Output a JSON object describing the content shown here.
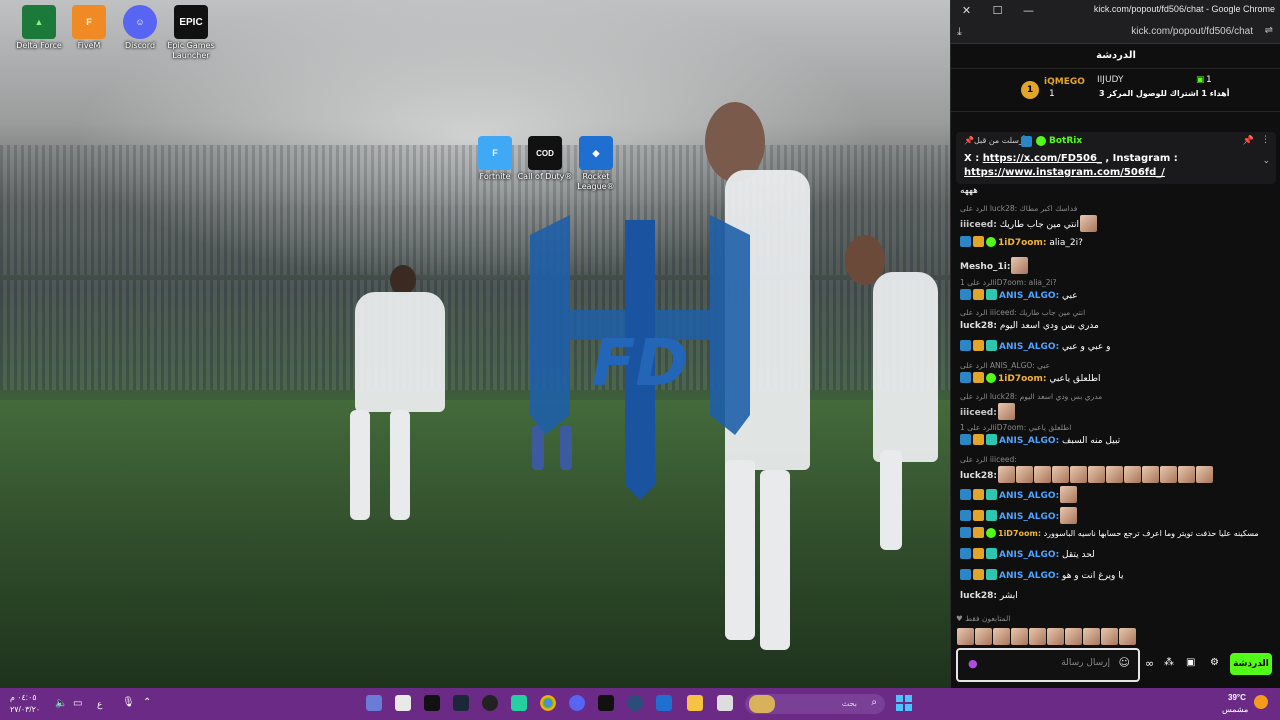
{
  "desktop_icons": [
    {
      "name": "delta-force-icon",
      "label": "Delta Force",
      "color": "#1b7a3a"
    },
    {
      "name": "fivem-icon",
      "label": "FiveM",
      "color": "#f08a24"
    },
    {
      "name": "discord-icon",
      "label": "Discord",
      "color": "#5865f2"
    },
    {
      "name": "epic-games-icon",
      "label": "Epic Games Launcher",
      "color": "#111111"
    },
    {
      "name": "fortnite-icon",
      "label": "Fortnite",
      "color": "#3fa9f5"
    },
    {
      "name": "call-of-duty-icon",
      "label": "Call of Duty®",
      "color": "#111111"
    },
    {
      "name": "rocket-league-icon",
      "label": "Rocket League®",
      "color": "#1e6fd0"
    }
  ],
  "browser": {
    "title": "kick.com/popout/fd506/chat - Google Chrome",
    "url": "kick.com/popout/fd506/chat",
    "accent": "#53fc18"
  },
  "chat": {
    "header": "الدردشة",
    "leaderboard": {
      "top": {
        "rank": "1",
        "user": "iQMEGO",
        "count": "1"
      },
      "second": {
        "user": "IIJUDY",
        "count": "1"
      },
      "gift_line": "أهداء 1 اشتراك للوصول المركز 3"
    },
    "pinned": {
      "author": "BotRix",
      "pinned_by": "أرسلت من قبل",
      "text": "X :",
      "link1": "https://x.com/FD506_",
      "mid": ", Instagram :",
      "link2": "https://www.instagram.com/506fd_/"
    },
    "messages": [
      {
        "reply": "",
        "user": "",
        "text": "هههه"
      },
      {
        "reply": "الرد على luck28: فداسك اكبر مطاك",
        "user": "iiiceed:",
        "text": "انتي مين جاب طاريك"
      },
      {
        "reply": "",
        "user": "1iD7oom:",
        "text": "alia_2i?"
      },
      {
        "reply": "",
        "user": "Mesho_1i:",
        "text": ""
      },
      {
        "reply": "الرد على 1iD7oom: alia_2i?",
        "user": "ANIS_ALGO:",
        "text": "عبي"
      },
      {
        "reply": "الرد على iiiceed: انتي مين جاب طاريك",
        "user": "luck28:",
        "text": "مدري بس ودي اسعد اليوم"
      },
      {
        "reply": "",
        "user": "ANIS_ALGO:",
        "text": "و عبي و عبي"
      },
      {
        "reply": "الرد على ANIS_ALGO: عبي",
        "user": "1iD7oom:",
        "text": "اطلعلق ياعبي"
      },
      {
        "reply": "الرد على luck28: مدري بس ودي اسعد اليوم",
        "user": "iiiceed:",
        "text": ""
      },
      {
        "reply": "الرد على 1iD7oom: اطلعلق ياعبي",
        "user": "ANIS_ALGO:",
        "text": "تبيل منه السبف"
      },
      {
        "reply": "الرد على iiiceed:",
        "user": "luck28:",
        "text": ""
      },
      {
        "reply": "",
        "user": "ANIS_ALGO:",
        "text": ""
      },
      {
        "reply": "",
        "user": "ANIS_ALGO:",
        "text": ""
      },
      {
        "reply": "",
        "user": "1iD7oom:",
        "text": "مسكينه عليا حذفت تويتر وما اعرف ترجع حسابها ناسيه الباسوورد"
      },
      {
        "reply": "",
        "user": "ANIS_ALGO:",
        "text": "لحد يتقل"
      },
      {
        "reply": "",
        "user": "ANIS_ALGO:",
        "text": "يا ويرغ انت و هو"
      },
      {
        "reply": "",
        "user": "luck28:",
        "text": "ابشر"
      }
    ],
    "viewers_label": "المتابعون فقط",
    "input_placeholder": "إرسال رسالة",
    "send_label": "الدردشة"
  },
  "taskbar": {
    "search_placeholder": "بحث",
    "weather_temp": "39°C",
    "weather_desc": "مشمس",
    "time": "٠٤:٠٥ م",
    "date": "٢٧/٠٣/٢٠",
    "lang": "ع"
  }
}
